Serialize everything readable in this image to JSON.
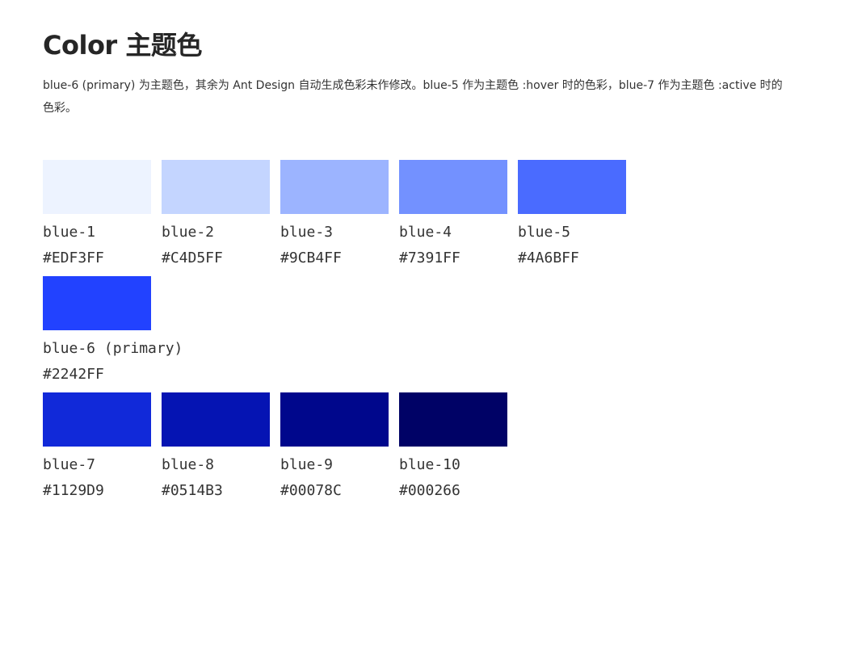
{
  "title": "Color 主题色",
  "description": "blue-6 (primary) 为主题色，其余为 Ant Design 自动生成色彩未作修改。blue-5 作为主题色 :hover 时的色彩，blue-7 作为主题色 :active 时的色彩。",
  "rows": [
    [
      {
        "name": "blue-1",
        "hex": "#EDF3FF",
        "color": "#EDF3FF"
      },
      {
        "name": "blue-2",
        "hex": "#C4D5FF",
        "color": "#C4D5FF"
      },
      {
        "name": "blue-3",
        "hex": "#9CB4FF",
        "color": "#9CB4FF"
      },
      {
        "name": "blue-4",
        "hex": "#7391FF",
        "color": "#7391FF"
      },
      {
        "name": "blue-5",
        "hex": "#4A6BFF",
        "color": "#4A6BFF"
      }
    ],
    [
      {
        "name": "blue-6 (primary)",
        "hex": "#2242FF",
        "color": "#2242FF"
      }
    ],
    [
      {
        "name": "blue-7",
        "hex": "#1129D9",
        "color": "#1129D9"
      },
      {
        "name": "blue-8",
        "hex": "#0514B3",
        "color": "#0514B3"
      },
      {
        "name": "blue-9",
        "hex": "#00078C",
        "color": "#00078C"
      },
      {
        "name": "blue-10",
        "hex": "#000266",
        "color": "#000266"
      }
    ]
  ]
}
